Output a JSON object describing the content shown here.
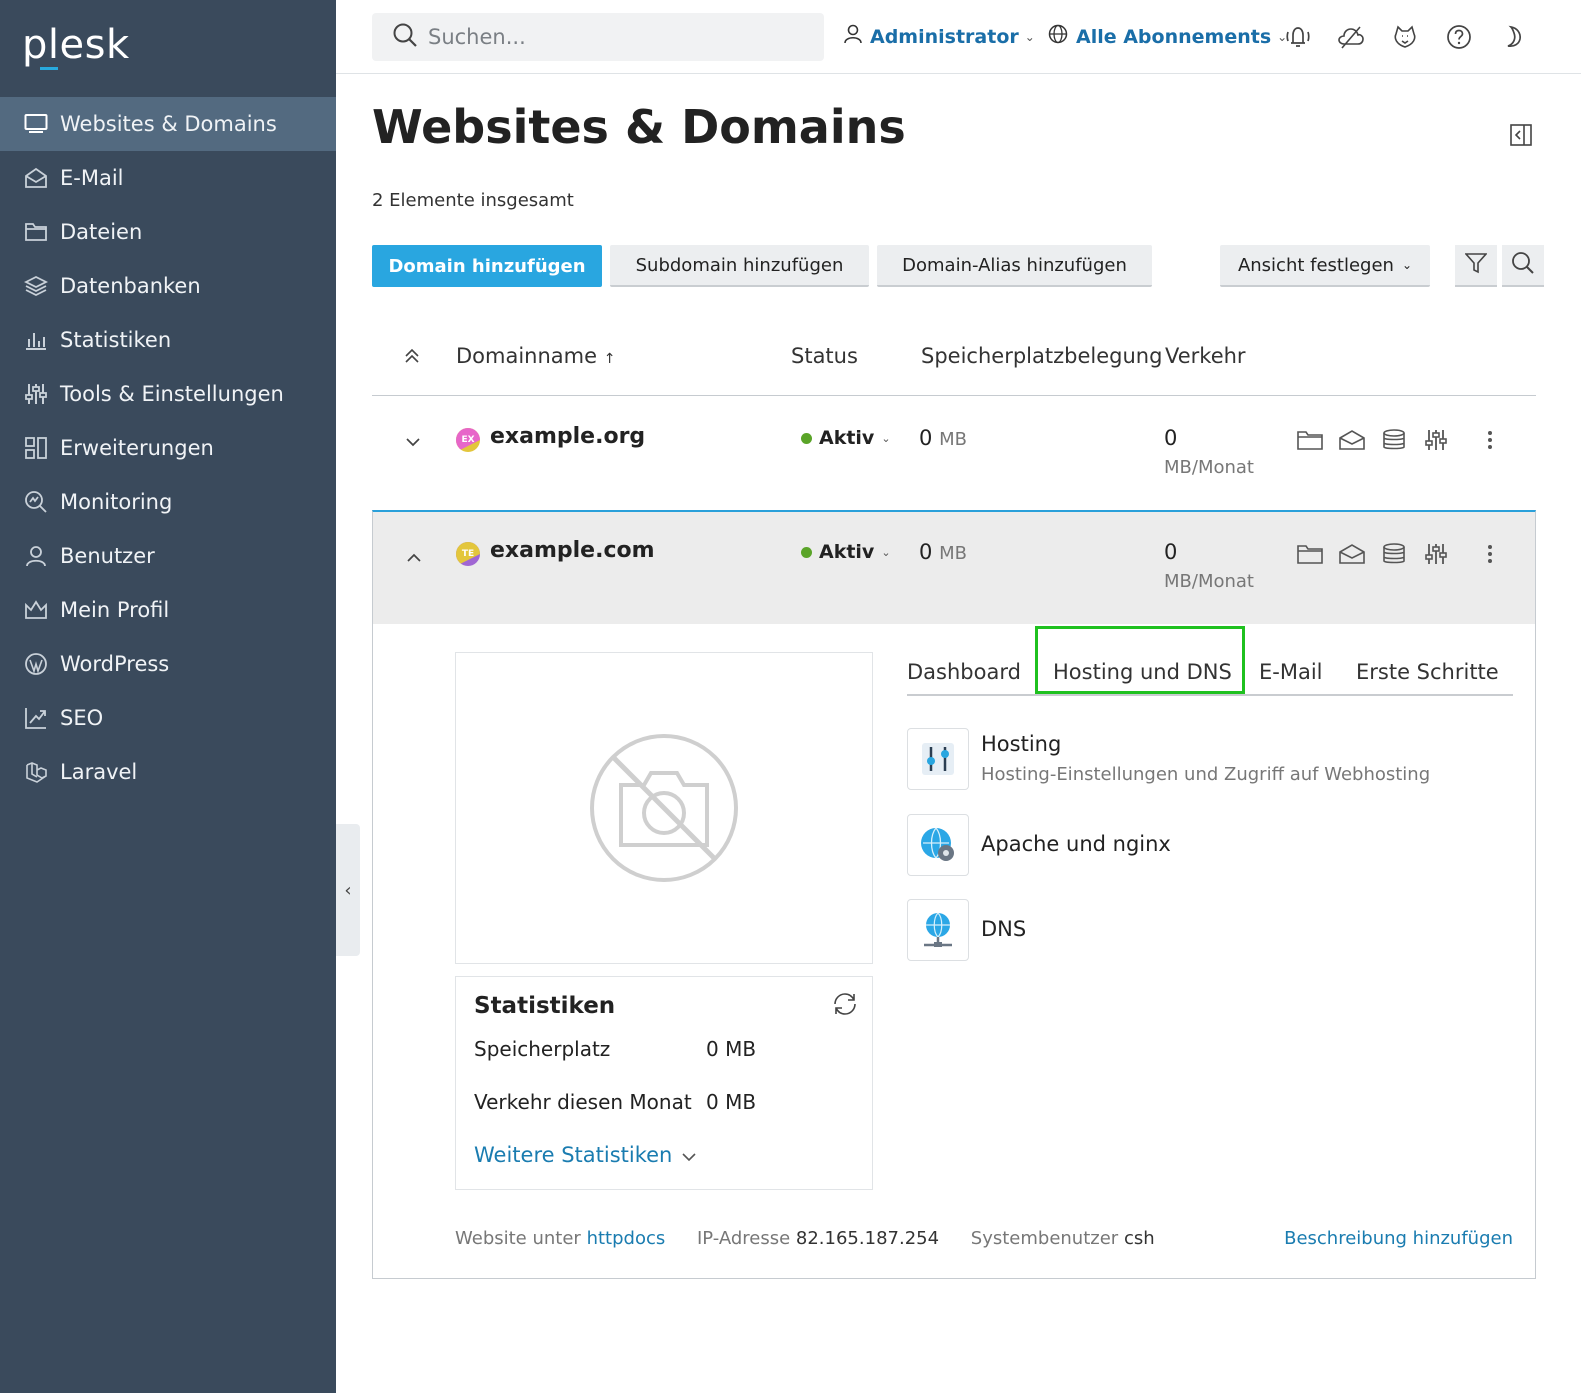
{
  "brand": {
    "logo": "plesk",
    "accent": "#28aade",
    "sidebar_bg": "#3a4a5c"
  },
  "sidebar": {
    "items": [
      {
        "label": "Websites & Domains",
        "icon": "monitor-icon",
        "active": true
      },
      {
        "label": "E-Mail",
        "icon": "envelope-icon"
      },
      {
        "label": "Dateien",
        "icon": "folder-icon"
      },
      {
        "label": "Datenbanken",
        "icon": "database-icon"
      },
      {
        "label": "Statistiken",
        "icon": "bar-chart-icon"
      },
      {
        "label": "Tools & Einstellungen",
        "icon": "sliders-icon"
      },
      {
        "label": "Erweiterungen",
        "icon": "extensions-icon"
      },
      {
        "label": "Monitoring",
        "icon": "monitoring-icon"
      },
      {
        "label": "Benutzer",
        "icon": "user-icon"
      },
      {
        "label": "Mein Profil",
        "icon": "crown-icon"
      },
      {
        "label": "WordPress",
        "icon": "wordpress-icon"
      },
      {
        "label": "SEO",
        "icon": "seo-icon"
      },
      {
        "label": "Laravel",
        "icon": "laravel-icon"
      }
    ]
  },
  "topbar": {
    "search_placeholder": "Suchen...",
    "user": "Administrator",
    "subscriptions": "Alle Abonnements",
    "icons": [
      "notifications-icon",
      "cloud-off-icon",
      "feedback-icon",
      "help-icon",
      "dark-mode-icon"
    ]
  },
  "page": {
    "title": "Websites & Domains",
    "total": "2 Elemente insgesamt"
  },
  "toolbar": {
    "add_domain": "Domain hinzufügen",
    "add_subdomain": "Subdomain hinzufügen",
    "add_alias": "Domain-Alias hinzufügen",
    "view": "Ansicht festlegen"
  },
  "table": {
    "columns": {
      "name": "Domainname",
      "name_sort": "↑",
      "status": "Status",
      "storage": "Speicherplatzbelegung",
      "traffic": "Verkehr"
    },
    "rows": [
      {
        "avatar": "EX",
        "avatar_color": "#e3c63c",
        "domain": "example.org",
        "status": "Aktiv",
        "storage_value": "0",
        "storage_unit": "MB",
        "traffic_value": "0",
        "traffic_unit": "MB/Monat"
      },
      {
        "avatar": "TE",
        "avatar_color": "#a066d3",
        "domain": "example.com",
        "status": "Aktiv",
        "storage_value": "0",
        "storage_unit": "MB",
        "traffic_value": "0",
        "traffic_unit": "MB/Monat"
      }
    ]
  },
  "detail": {
    "stats": {
      "title": "Statistiken",
      "storage_label": "Speicherplatz",
      "storage_value": "0 MB",
      "traffic_label": "Verkehr diesen Monat",
      "traffic_value": "0 MB",
      "more": "Weitere Statistiken"
    },
    "tabs": [
      "Dashboard",
      "Hosting und DNS",
      "E-Mail",
      "Erste Schritte"
    ],
    "active_tab": "Hosting und DNS",
    "tools": [
      {
        "title": "Hosting",
        "desc": "Hosting-Einstellungen und Zugriff auf Webhosting",
        "icon": "hosting-settings-icon"
      },
      {
        "title": "Apache und nginx",
        "desc": "",
        "icon": "apache-nginx-icon"
      },
      {
        "title": "DNS",
        "desc": "",
        "icon": "dns-icon"
      }
    ],
    "footer": {
      "website_label": "Website unter",
      "website_link": "httpdocs",
      "ip_label": "IP-Adresse",
      "ip_value": "82.165.187.254",
      "sysuser_label": "Systembenutzer",
      "sysuser_value": "csh",
      "add_description": "Beschreibung hinzufügen"
    }
  }
}
